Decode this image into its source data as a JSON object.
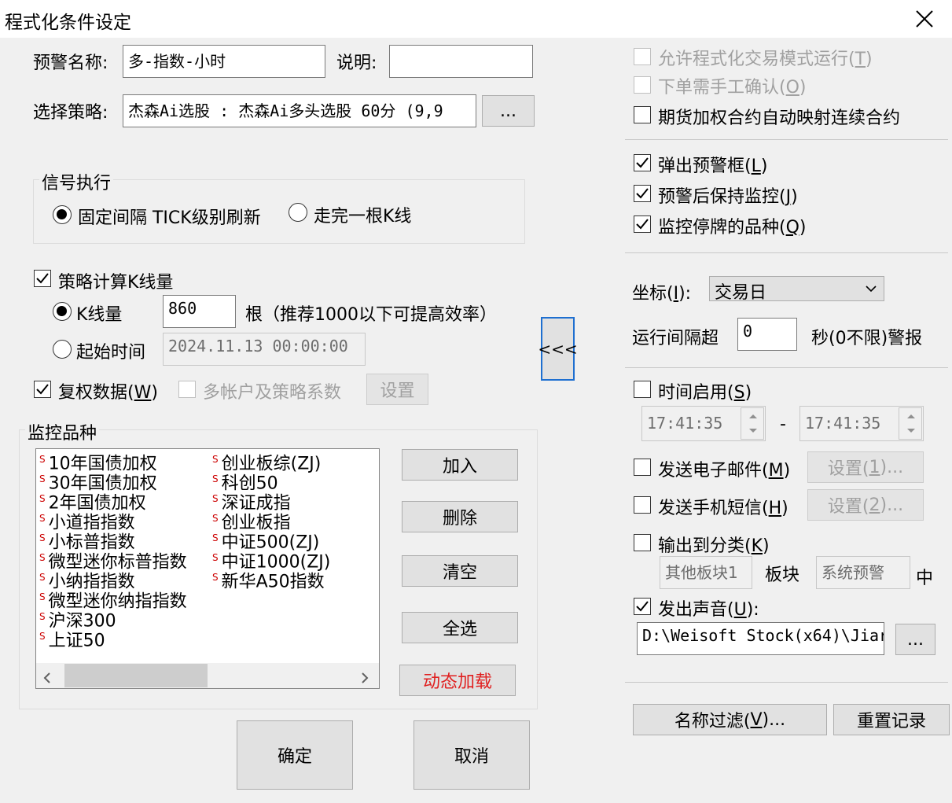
{
  "window": {
    "title": "程式化条件设定"
  },
  "alert_name": {
    "label": "预警名称:",
    "value": "多-指数-小时"
  },
  "description": {
    "label": "说明:",
    "value": ""
  },
  "strategy": {
    "label": "选择策略:",
    "value": "杰森Ai选股 : 杰森Ai多头选股 60分 (9,9",
    "browse": "..."
  },
  "signal_exec": {
    "title": "信号执行",
    "options": [
      "固定间隔 TICK级别刷新",
      "走完一根K线"
    ],
    "selected": 0
  },
  "kline_calc": {
    "label": "策略计算K线量",
    "checked": true,
    "kline_count_label": "K线量",
    "kline_count_value": "860",
    "kline_count_hint": "根（推荐1000以下可提高效率）",
    "start_time_label": "起始时间",
    "start_time_value": "2024.11.13 00:00:00",
    "selected": "kline_count"
  },
  "adjusted": {
    "label": "复权数据(",
    "key": "W",
    "tail": ")",
    "checked": true
  },
  "multi_account": {
    "label": "多帐户及策略系数",
    "checked": false,
    "button": "设置"
  },
  "monitor": {
    "title": "监控品种",
    "col1": [
      "10年国债加权",
      "30年国债加权",
      "2年国债加权",
      "小道指指数",
      "小标普指数",
      "微型迷你标普指数",
      "小纳指指数",
      "微型迷你纳指指数",
      "沪深300",
      "上证50"
    ],
    "col2": [
      "创业板综(ZJ)",
      "科创50",
      "深证成指",
      "创业板指",
      "中证500(ZJ)",
      "中证1000(ZJ)",
      "新华A50指数"
    ],
    "buttons": {
      "add": "加入",
      "delete": "删除",
      "clear": "清空",
      "select_all": "全选",
      "dynamic": "动态加载"
    }
  },
  "collapse_button": "<<<",
  "footer": {
    "ok": "确定",
    "cancel": "取消"
  },
  "right": {
    "allow_prog": {
      "label": "允许程式化交易模式运行(",
      "key": "T",
      "tail": ")",
      "checked": false
    },
    "manual_confirm": {
      "label": "下单需手工确认(",
      "key": "O",
      "tail": ")",
      "checked": false
    },
    "futures_map": {
      "label": "期货加权合约自动映射连续合约",
      "checked": false
    },
    "popup": {
      "label": "弹出预警框(",
      "key": "L",
      "tail": ")",
      "checked": true
    },
    "keep_monitor": {
      "label": "预警后保持监控(",
      "key": "J",
      "tail": ")",
      "checked": true
    },
    "monitor_suspended": {
      "label": "监控停牌的品种(",
      "key": "Q",
      "tail": ")",
      "checked": true
    },
    "coord": {
      "label": "坐标(",
      "key": "I",
      "tail": "):",
      "value": "交易日"
    },
    "interval": {
      "label": "运行间隔超",
      "value": "0",
      "suffix": "秒(0不限)警报"
    },
    "time_enable": {
      "label": "时间启用(",
      "key": "S",
      "tail": ")",
      "checked": false,
      "from": "17:41:35",
      "dash": "-",
      "to": "17:41:35"
    },
    "email": {
      "label": "发送电子邮件(",
      "key": "M",
      "tail": ")",
      "checked": false,
      "button_pre": "设置(",
      "button_key": "1",
      "button_tail": ")..."
    },
    "sms": {
      "label": "发送手机短信(",
      "key": "H",
      "tail": ")",
      "checked": false,
      "button_pre": "设置(",
      "button_key": "2",
      "button_tail": ")..."
    },
    "output_class": {
      "label": "输出到分类(",
      "key": "K",
      "tail": ")",
      "checked": false,
      "field1": "其他板块1",
      "mid": "板块",
      "field2": "系统预警",
      "end": "中"
    },
    "sound": {
      "label": "发出声音(",
      "key": "U",
      "tail": "):",
      "checked": true,
      "path": "D:\\Weisoft Stock(x64)\\Jiar",
      "browse": "..."
    },
    "name_filter": {
      "pre": "名称过滤(",
      "key": "V",
      "tail": ")..."
    },
    "reset_record": "重置记录"
  }
}
